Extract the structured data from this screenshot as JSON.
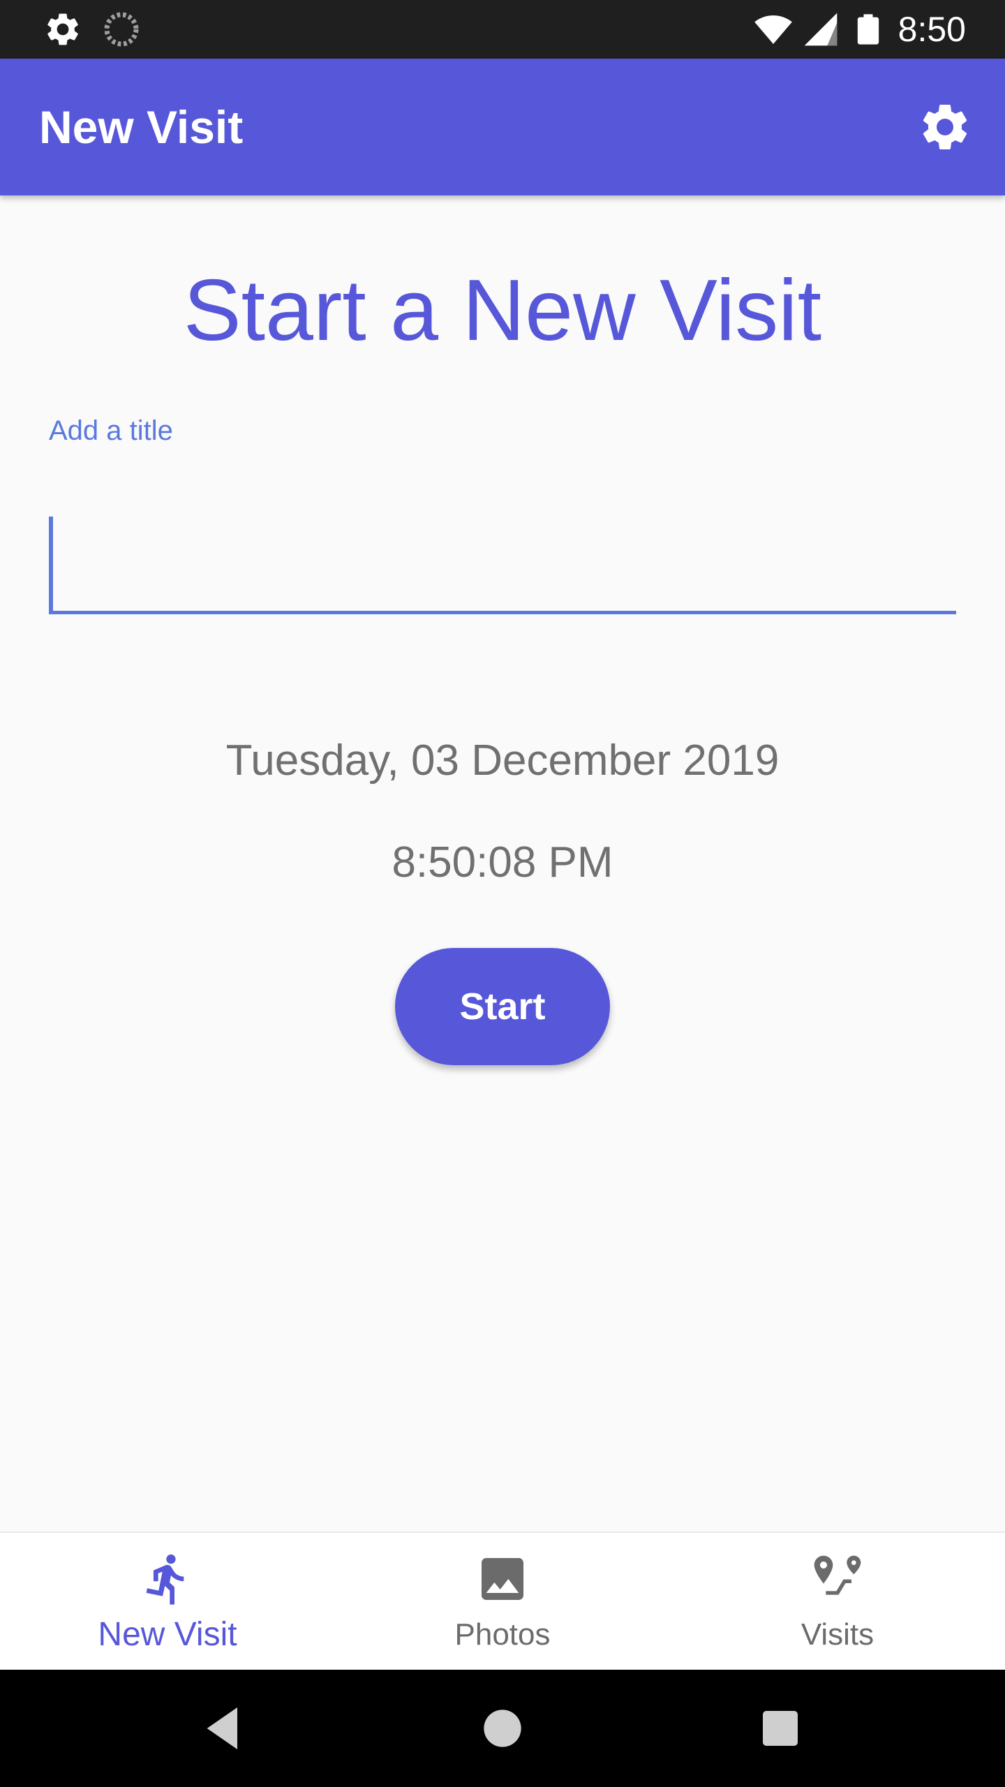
{
  "status_bar": {
    "time": "8:50",
    "icons": [
      "settings-icon",
      "sync-icon",
      "wifi-icon",
      "cellular-signal-icon",
      "battery-icon"
    ]
  },
  "app_bar": {
    "title": "New Visit",
    "action_icon": "settings-icon"
  },
  "main": {
    "heading": "Start a New Visit",
    "title_field": {
      "label": "Add a title",
      "value": ""
    },
    "date": "Tuesday, 03 December 2019",
    "time": "8:50:08 PM",
    "start_label": "Start"
  },
  "bottom_nav": {
    "items": [
      {
        "label": "New Visit",
        "icon": "run-icon",
        "active": true
      },
      {
        "label": "Photos",
        "icon": "image-icon",
        "active": false
      },
      {
        "label": "Visits",
        "icon": "route-icon",
        "active": false
      }
    ]
  },
  "system_nav": {
    "buttons": [
      "back-icon",
      "home-icon",
      "recents-icon"
    ]
  },
  "colors": {
    "primary": "#5757d9",
    "accent": "#5a79dd",
    "status_bar": "#1f1f1f",
    "background": "#fafafa",
    "secondary_text": "#707070"
  }
}
